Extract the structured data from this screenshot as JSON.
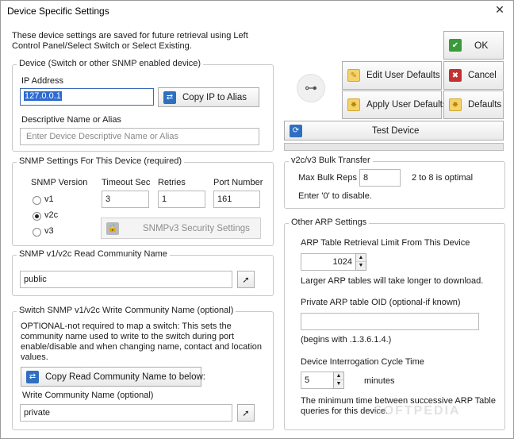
{
  "window": {
    "title": "Device Specific Settings",
    "close_glyph": "✕"
  },
  "intro": "These device settings are saved for future retrieval using Left Control Panel/Select Switch or Select Existing.",
  "buttons": {
    "ok": "OK",
    "edit_user_defaults": "Edit User Defaults",
    "cancel": "Cancel",
    "apply_user_defaults": "Apply User Defaults",
    "defaults": "Defaults",
    "test_device": "Test Device",
    "copy_ip_to_alias": "Copy IP to Alias",
    "snmpv3_security_settings": "SNMPv3 Security Settings",
    "copy_read_community": "Copy Read Community Name to below:"
  },
  "device_group": {
    "legend": "Device (Switch or other SNMP enabled device)",
    "ip_label": "IP Address",
    "ip_value": "127.0.0.1",
    "alias_label": "Descriptive Name or Alias",
    "alias_placeholder": "Enter Device Descriptive Name or Alias"
  },
  "snmp_group": {
    "legend": "SNMP Settings For This Device (required)",
    "version_label": "SNMP Version",
    "versions": [
      "v1",
      "v2c",
      "v3"
    ],
    "selected_version": "v2c",
    "timeout_label": "Timeout Sec",
    "timeout_value": "3",
    "retries_label": "Retries",
    "retries_value": "1",
    "port_label": "Port Number",
    "port_value": "161"
  },
  "read_community": {
    "legend": "SNMP v1/v2c Read Community Name",
    "value": "public"
  },
  "write_community": {
    "legend": "Switch SNMP v1/v2c Write Community Name (optional)",
    "description": "OPTIONAL-not required to map a switch: This sets the community name used to write to the switch during port enable/disable and when changing name, contact and location values.",
    "field_label": "Write Community Name (optional)",
    "value": "private"
  },
  "bulk_group": {
    "legend": "v2c/v3 Bulk Transfer",
    "max_label": "Max Bulk Reps",
    "max_value": "8",
    "hint": "2 to 8 is optimal",
    "disable_hint": "Enter '0' to disable."
  },
  "arp_group": {
    "legend": "Other ARP Settings",
    "limit_label": "ARP Table Retrieval Limit From This Device",
    "limit_value": "1024",
    "limit_note": "Larger ARP tables will take longer to download.",
    "oid_label": "Private ARP table OID (optional-if known)",
    "oid_value": "",
    "oid_note": "(begins with .1.3.6.1.4.)",
    "cycle_label": "Device Interrogation Cycle Time",
    "cycle_value": "5",
    "cycle_unit": "minutes",
    "cycle_note": "The minimum time between successive ARP Table queries for this device."
  },
  "test_progress": 0,
  "watermark": "SOFTPEDIA"
}
